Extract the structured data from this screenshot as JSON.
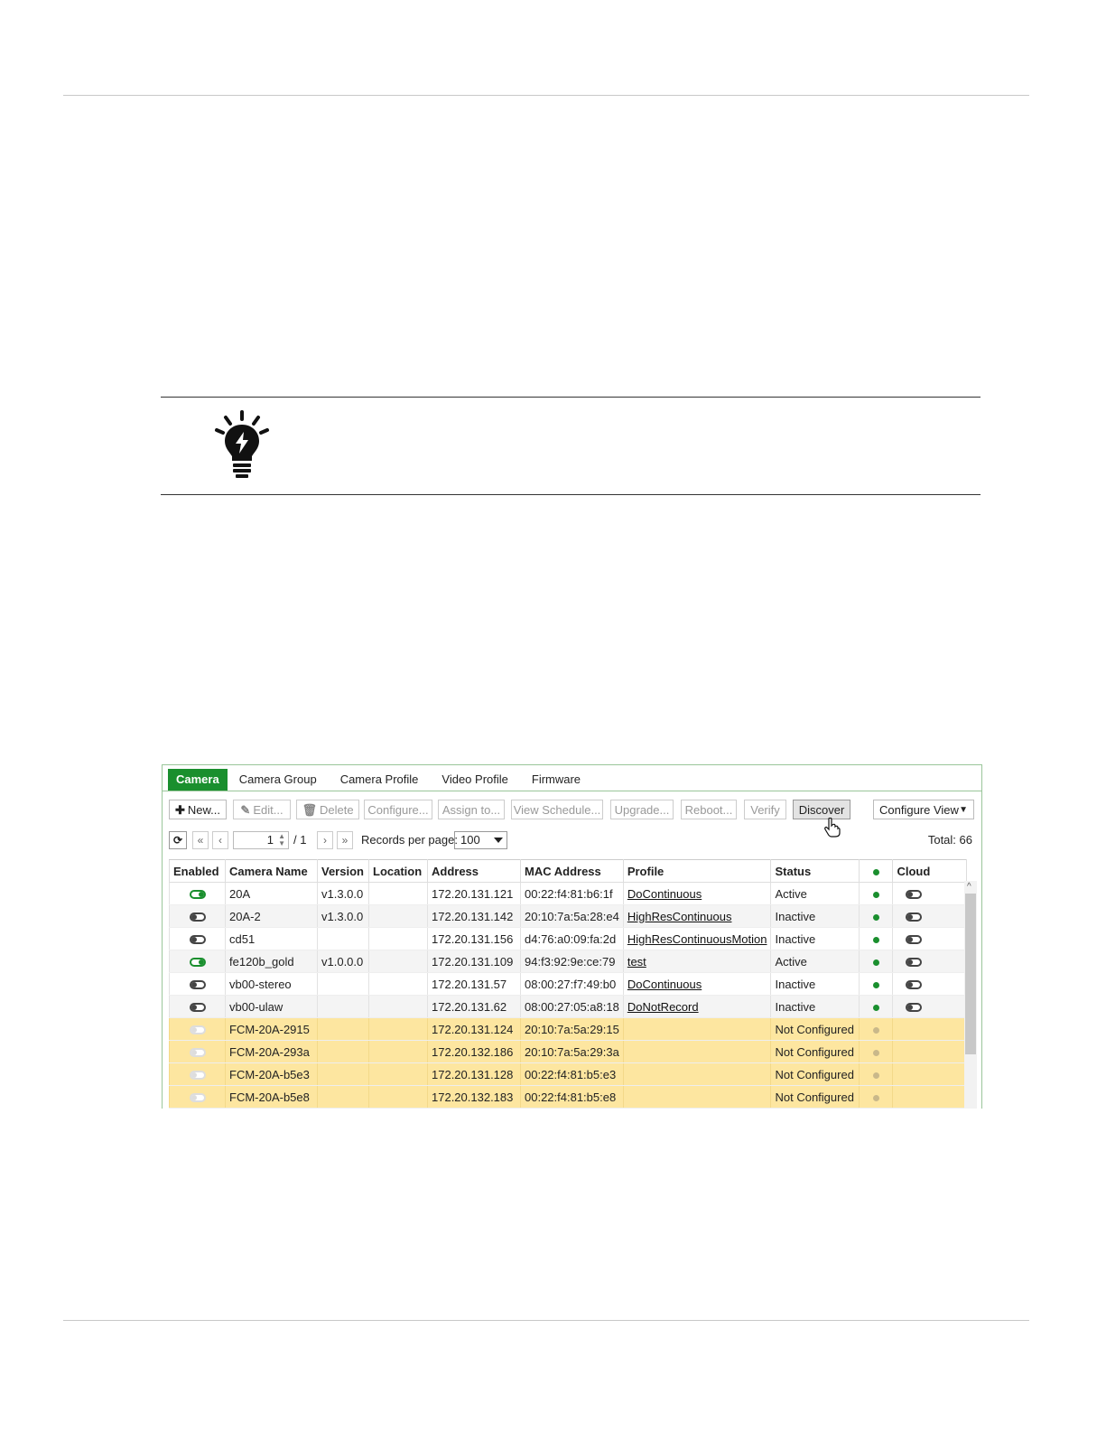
{
  "tabs": [
    {
      "label": "Camera",
      "active": true
    },
    {
      "label": "Camera Group"
    },
    {
      "label": "Camera Profile"
    },
    {
      "label": "Video Profile"
    },
    {
      "label": "Firmware"
    }
  ],
  "toolbar": {
    "new": "New...",
    "edit": "Edit...",
    "delete": "Delete",
    "configure": "Configure...",
    "assign": "Assign to...",
    "view_schedule": "View Schedule...",
    "upgrade": "Upgrade...",
    "reboot": "Reboot...",
    "verify": "Verify",
    "discover": "Discover",
    "configure_view": "Configure View"
  },
  "pager": {
    "current_page": "1",
    "total_pages": "/ 1",
    "records_label": "Records per page:",
    "records_value": "100",
    "total": "Total: 66"
  },
  "table": {
    "headers": [
      "Enabled",
      "Camera Name",
      "Version",
      "Location",
      "Address",
      "MAC Address",
      "Profile",
      "Status",
      "",
      "Cloud"
    ],
    "rows": [
      {
        "enabled": "on",
        "name": "20A",
        "version": "v1.3.0.0",
        "location": "",
        "address": "172.20.131.121",
        "mac": "00:22:f4:81:b6:1f",
        "profile": "DoContinuous",
        "status": "Active",
        "dot": "#1a8f2e",
        "cloud": "off"
      },
      {
        "enabled": "off",
        "name": "20A-2",
        "version": "v1.3.0.0",
        "location": "",
        "address": "172.20.131.142",
        "mac": "20:10:7a:5a:28:e4",
        "profile": "HighResContinuous",
        "status": "Inactive",
        "dot": "#1a8f2e",
        "cloud": "off"
      },
      {
        "enabled": "off",
        "name": "cd51",
        "version": "",
        "location": "",
        "address": "172.20.131.156",
        "mac": "d4:76:a0:09:fa:2d",
        "profile": "HighResContinuousMotion",
        "status": "Inactive",
        "dot": "#1a8f2e",
        "cloud": "off"
      },
      {
        "enabled": "on",
        "name": "fe120b_gold",
        "version": "v1.0.0.0",
        "location": "",
        "address": "172.20.131.109",
        "mac": "94:f3:92:9e:ce:79",
        "profile": "test",
        "status": "Active",
        "dot": "#1a8f2e",
        "cloud": "off"
      },
      {
        "enabled": "off",
        "name": "vb00-stereo",
        "version": "",
        "location": "",
        "address": "172.20.131.57",
        "mac": "08:00:27:f7:49:b0",
        "profile": "DoContinuous",
        "status": "Inactive",
        "dot": "#1a8f2e",
        "cloud": "off"
      },
      {
        "enabled": "off",
        "name": "vb00-ulaw",
        "version": "",
        "location": "",
        "address": "172.20.131.62",
        "mac": "08:00:27:05:a8:18",
        "profile": "DoNotRecord",
        "status": "Inactive",
        "dot": "#1a8f2e",
        "cloud": "off"
      },
      {
        "enabled": "dim",
        "name": "FCM-20A-2915",
        "version": "",
        "location": "",
        "address": "172.20.131.124",
        "mac": "20:10:7a:5a:29:15",
        "profile": "",
        "status": "Not Configured",
        "dot": "#c9b88a",
        "cloud": ""
      },
      {
        "enabled": "dim",
        "name": "FCM-20A-293a",
        "version": "",
        "location": "",
        "address": "172.20.132.186",
        "mac": "20:10:7a:5a:29:3a",
        "profile": "",
        "status": "Not Configured",
        "dot": "#c9b88a",
        "cloud": ""
      },
      {
        "enabled": "dim",
        "name": "FCM-20A-b5e3",
        "version": "",
        "location": "",
        "address": "172.20.131.128",
        "mac": "00:22:f4:81:b5:e3",
        "profile": "",
        "status": "Not Configured",
        "dot": "#c9b88a",
        "cloud": ""
      },
      {
        "enabled": "dim",
        "name": "FCM-20A-b5e8",
        "version": "",
        "location": "",
        "address": "172.20.132.183",
        "mac": "00:22:f4:81:b5:e8",
        "profile": "",
        "status": "Not Configured",
        "dot": "#c9b88a",
        "cloud": ""
      }
    ]
  },
  "colors": {
    "accent": "#1a8f2e",
    "not_configured_row": "#fde6a0"
  },
  "icons": {
    "tip": "lightbulb-icon",
    "refresh": "refresh-icon",
    "first": "double-chevron-left-icon",
    "prev": "chevron-left-icon",
    "next": "chevron-right-icon",
    "last": "double-chevron-right-icon",
    "cursor": "hand-pointer-icon"
  }
}
